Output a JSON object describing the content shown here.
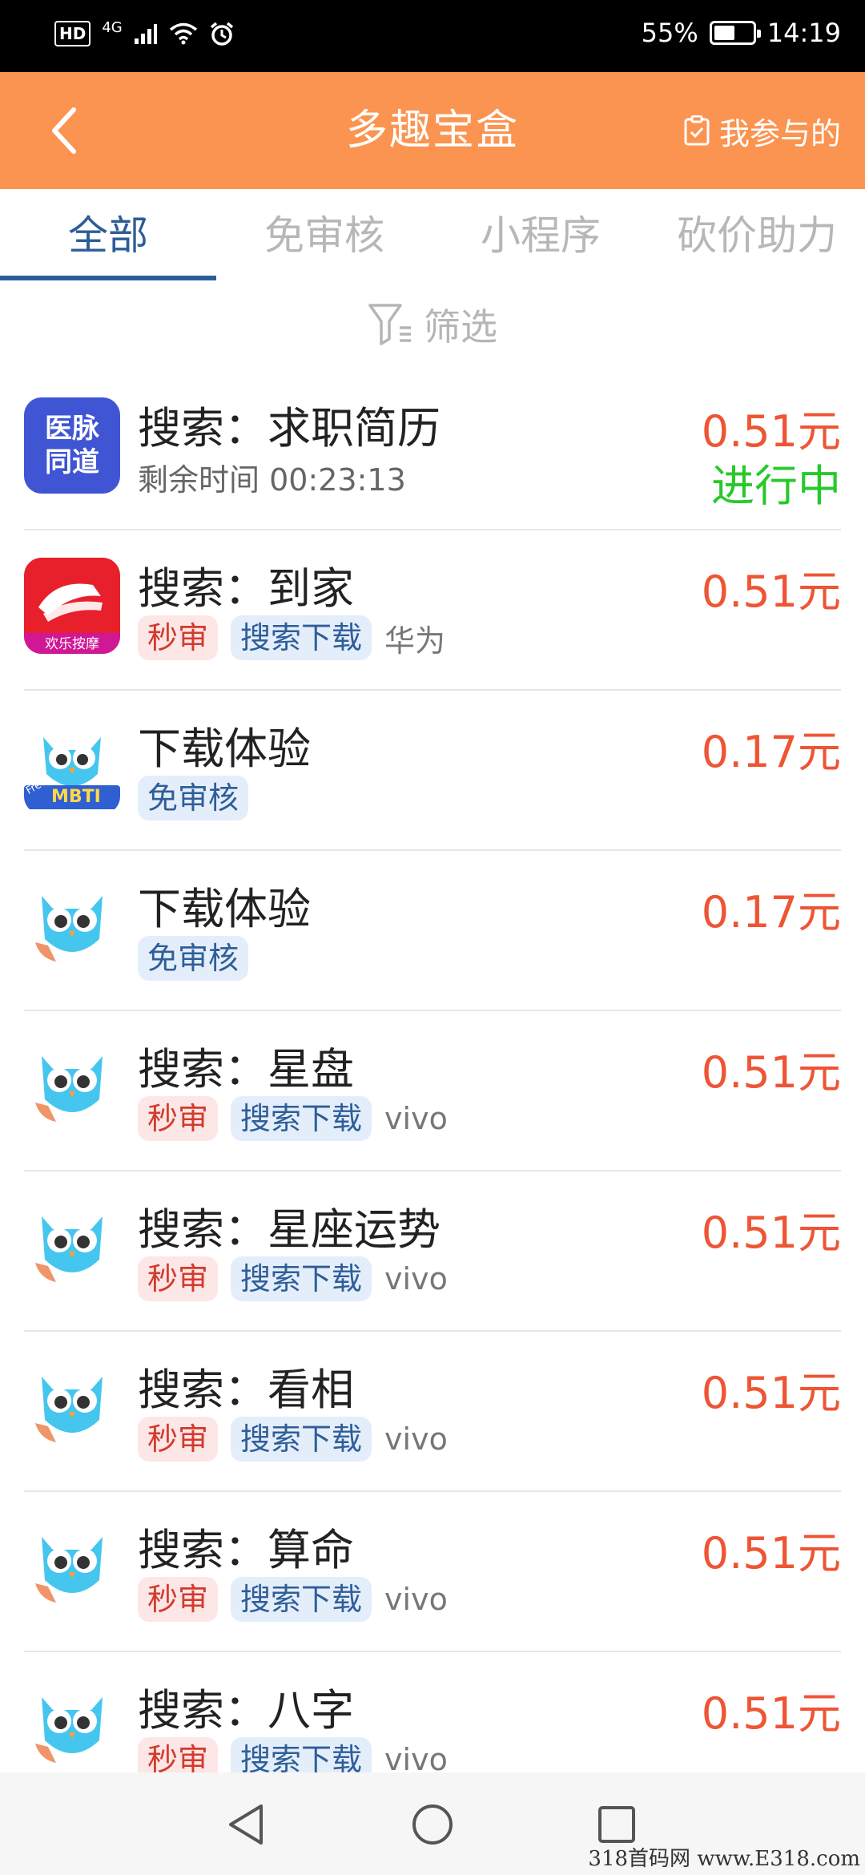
{
  "status_bar": {
    "hd": "HD",
    "network": "4G",
    "battery_percent": "55%",
    "battery_level": 0.55,
    "time": "14:19"
  },
  "app_bar": {
    "title": "多趣宝盒",
    "my_joined_label": "我参与的",
    "background": "#fb9450"
  },
  "tabs": [
    {
      "label": "全部",
      "active": true
    },
    {
      "label": "免审核",
      "active": false
    },
    {
      "label": "小程序",
      "active": false
    },
    {
      "label": "砍价助力",
      "active": false
    }
  ],
  "filter": {
    "label": "筛选"
  },
  "tasks": [
    {
      "icon": "yimai-tongdao-app-icon",
      "icon_text": [
        "医脉",
        "同道"
      ],
      "title": "搜索：求职简历",
      "remaining_label": "剩余时间 00:23:13",
      "price": "0.51元",
      "status": "进行中",
      "tags": [],
      "platform": ""
    },
    {
      "icon": "huanle-massage-app-icon",
      "icon_text": [
        "欢乐按摩"
      ],
      "title": "搜索：到家",
      "price": "0.51元",
      "tags": [
        "秒审",
        "搜索下载"
      ],
      "platform": "华为"
    },
    {
      "icon": "mbti-owl-app-icon",
      "icon_text": [
        "Free",
        "MBTI"
      ],
      "title": "下载体验",
      "price": "0.17元",
      "tags": [
        "免审核"
      ],
      "platform": ""
    },
    {
      "icon": "owl-app-icon",
      "title": "下载体验",
      "price": "0.17元",
      "tags": [
        "免审核"
      ],
      "platform": ""
    },
    {
      "icon": "owl-app-icon",
      "title": "搜索：星盘",
      "price": "0.51元",
      "tags": [
        "秒审",
        "搜索下载"
      ],
      "platform": "vivo"
    },
    {
      "icon": "owl-app-icon",
      "title": "搜索：星座运势",
      "price": "0.51元",
      "tags": [
        "秒审",
        "搜索下载"
      ],
      "platform": "vivo"
    },
    {
      "icon": "owl-app-icon",
      "title": "搜索：看相",
      "price": "0.51元",
      "tags": [
        "秒审",
        "搜索下载"
      ],
      "platform": "vivo"
    },
    {
      "icon": "owl-app-icon",
      "title": "搜索：算命",
      "price": "0.51元",
      "tags": [
        "秒审",
        "搜索下载"
      ],
      "platform": "vivo"
    },
    {
      "icon": "owl-app-icon",
      "title": "搜索：八字",
      "price": "0.51元",
      "tags": [
        "秒审",
        "搜索下载"
      ],
      "platform": "vivo"
    }
  ],
  "colors": {
    "accent": "#fb9450",
    "tab_active": "#2d5d98",
    "price": "#ee5534",
    "status_active": "#27c92a"
  },
  "watermark": "318首码网 www.E318.com"
}
